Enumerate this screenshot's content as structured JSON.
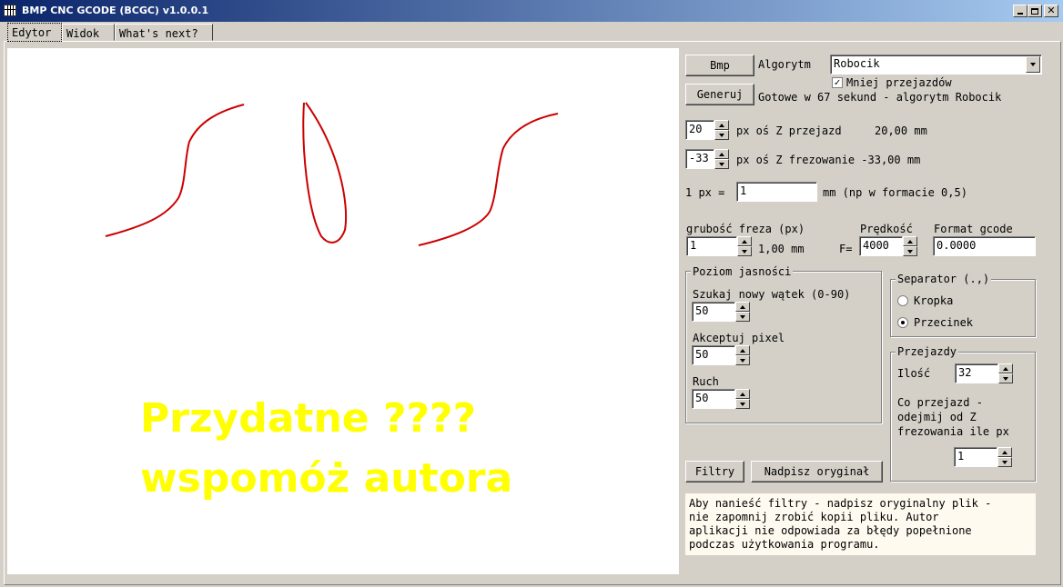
{
  "window": {
    "title": "BMP CNC GCODE (BCGC) v1.0.0.1"
  },
  "tabs": [
    {
      "label": "Edytor"
    },
    {
      "label": "Widok"
    },
    {
      "label": "What's next?"
    }
  ],
  "canvas": {
    "promo_line1": "Przydatne ????",
    "promo_line2": "wspomóż autora",
    "promo_color": "#ffff00",
    "stroke_color": "#cc0000"
  },
  "panel": {
    "bmp_button": "Bmp",
    "algorithm_label": "Algorytm",
    "algorithm_value": "Robocik",
    "fewer_passes_label": "Mniej przejazdów",
    "fewer_passes_checked": true,
    "generate_button": "Generuj",
    "status": "Gotowe w 67 sekund - algorytm Robocik",
    "z_travel_value": "20",
    "z_travel_label": "px oś Z przejazd",
    "z_travel_mm": "20,00 mm",
    "z_mill_value": "-33",
    "z_mill_label": "px oś Z frezowanie -33,00 mm",
    "px_label": "1 px =",
    "px_value": "1",
    "px_hint": "mm (np w formacie 0,5)",
    "cutter_label": "grubość freza (px)",
    "cutter_value": "1",
    "cutter_mm": "1,00 mm",
    "speed_label": "Prędkość",
    "speed_prefix": "F=",
    "speed_value": "4000",
    "gcode_format_label": "Format gcode",
    "gcode_format_value": "0.0000",
    "brightness": {
      "title": "Poziom jasności",
      "search_label": "Szukaj nowy wątek (0-90)",
      "search_value": "50",
      "accept_label": "Akceptuj pixel",
      "accept_value": "50",
      "move_label": "Ruch",
      "move_value": "50"
    },
    "separator": {
      "title": "Separator (.,)",
      "dot_label": "Kropka",
      "comma_label": "Przecinek",
      "selected": "Przecinek"
    },
    "passes": {
      "title": "Przejazdy",
      "count_label": "Ilość",
      "count_value": "32",
      "subtract_label": "Co przejazd -\nodejmij od Z\nfrezowania ile px",
      "subtract_value": "1"
    },
    "filters_button": "Filtry",
    "overwrite_button": "Nadpisz oryginał",
    "notice": "Aby nanieść filtry - nadpisz oryginalny plik -\nnie zapomnij zrobić kopii pliku. Autor\naplikacji nie odpowiada za błędy popełnione\npodczas użytkowania programu."
  }
}
